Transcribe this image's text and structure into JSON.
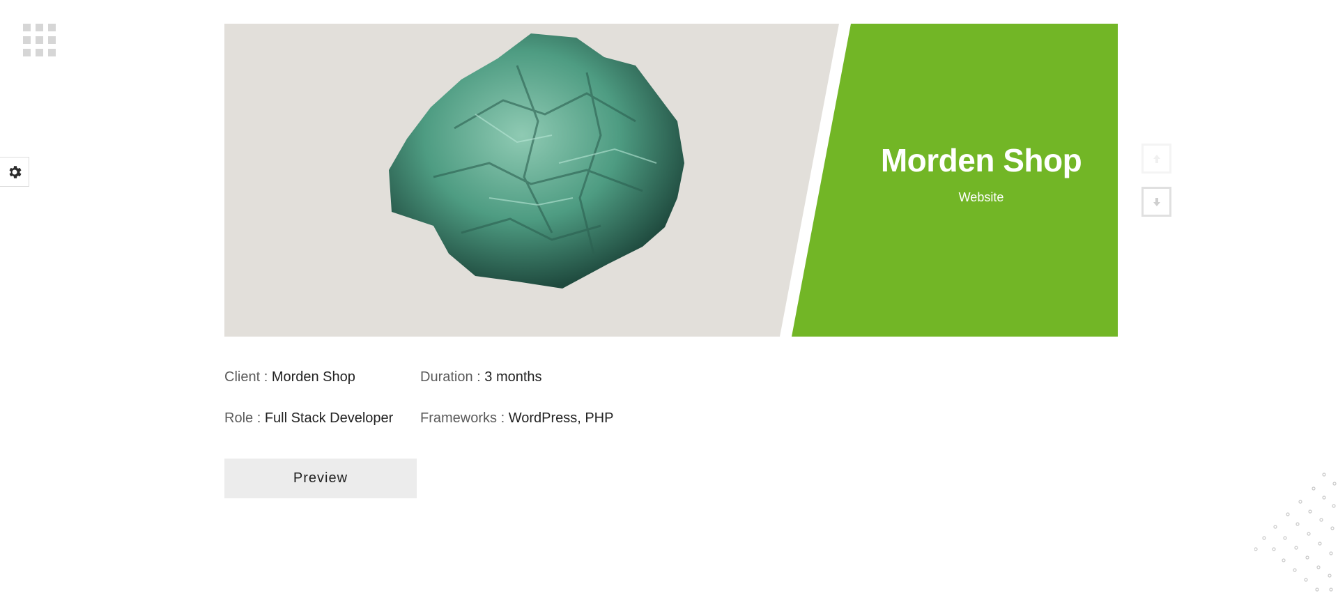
{
  "icons": {
    "menu": "grid-icon",
    "settings": "gear-icon",
    "nav_up": "arrow-up-icon",
    "nav_down": "arrow-down-icon"
  },
  "colors": {
    "accent": "#72b626",
    "hero_background": "#e2dfda",
    "button_background": "#ececec"
  },
  "hero": {
    "title": "Morden Shop",
    "subtitle": "Website"
  },
  "details": {
    "client_label": "Client :",
    "client_value": "Morden Shop",
    "duration_label": "Duration :",
    "duration_value": "3 months",
    "role_label": "Role :",
    "role_value": "Full Stack Developer",
    "frameworks_label": "Frameworks :",
    "frameworks_value": "WordPress, PHP"
  },
  "preview_label": "Preview"
}
